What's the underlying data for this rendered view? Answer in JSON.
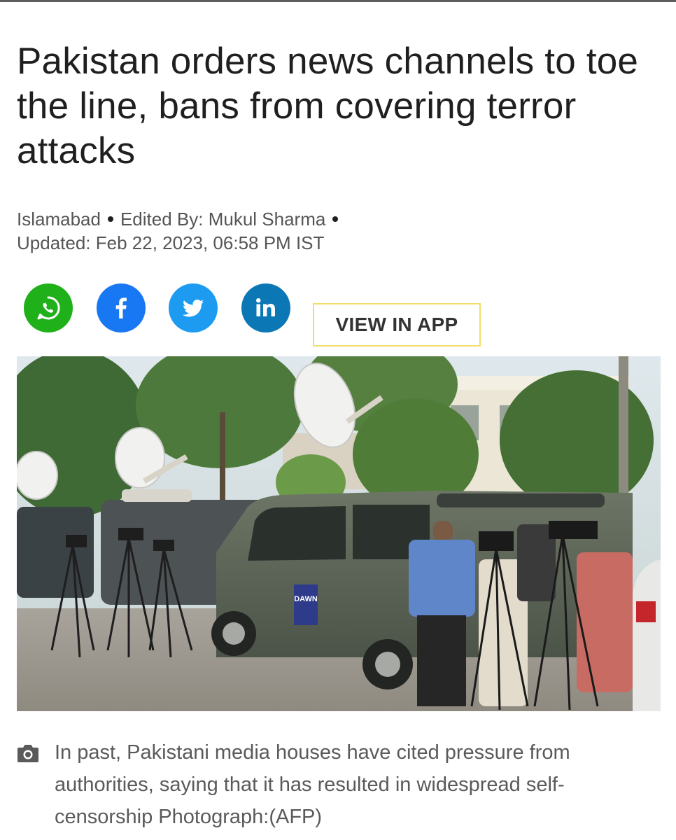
{
  "article": {
    "headline": "Pakistan orders news channels to toe the line, bans from covering terror attacks",
    "location": "Islamabad",
    "edited_by": "Edited By: Mukul Sharma",
    "updated": "Updated: Feb 22, 2023, 06:58 PM IST"
  },
  "share": {
    "buttons": [
      {
        "icon": "whatsapp-icon",
        "color": "#1fb01a"
      },
      {
        "icon": "facebook-icon",
        "color": "#1877f2"
      },
      {
        "icon": "twitter-icon",
        "color": "#1d9bf0"
      },
      {
        "icon": "linkedin-icon",
        "color": "#0b78b5"
      }
    ],
    "view_in_app": "VIEW IN APP",
    "view_in_app_border": "#f2dd6c"
  },
  "photo": {
    "van_text": "DAWN"
  },
  "caption": {
    "icon": "camera-icon",
    "text": "In past, Pakistani media houses have cited pressure from authorities, saying that it has resulted in widespread self-censorship Photograph:(AFP)"
  }
}
